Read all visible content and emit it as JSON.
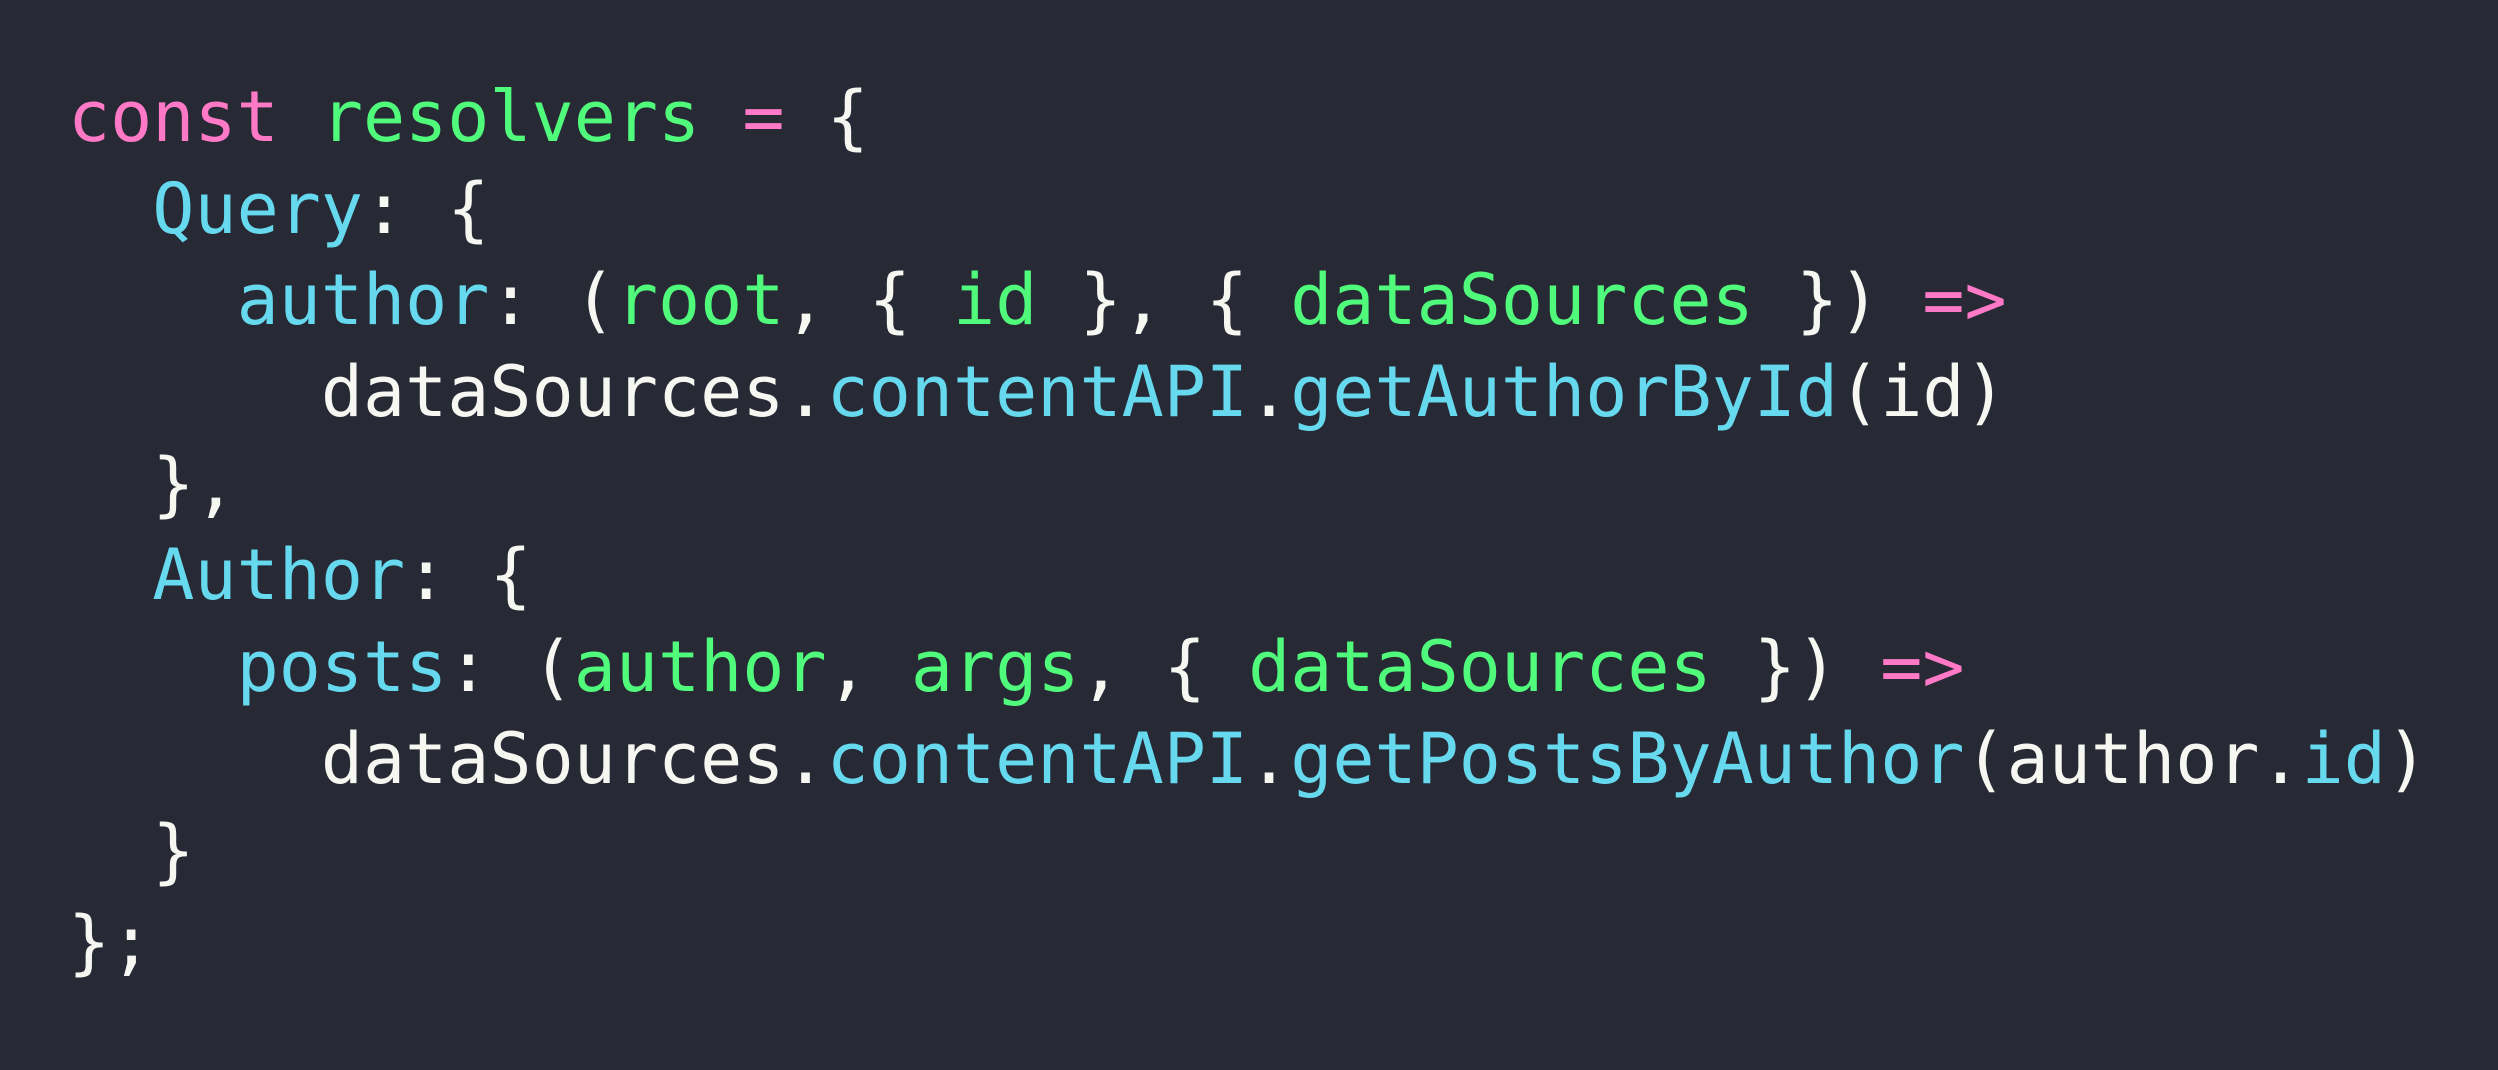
{
  "colors": {
    "background": "#272935",
    "plain": "#f7f7f2",
    "keyword": "#ff79c6",
    "variable": "#50fa7b",
    "property": "#66d9ef"
  },
  "lines": [
    [
      {
        "text": "const",
        "role": "keyword"
      },
      {
        "text": " ",
        "role": "plain"
      },
      {
        "text": "resolvers",
        "role": "variable"
      },
      {
        "text": " ",
        "role": "plain"
      },
      {
        "text": "=",
        "role": "keyword"
      },
      {
        "text": " {",
        "role": "plain"
      }
    ],
    [
      {
        "text": "  ",
        "role": "plain"
      },
      {
        "text": "Query",
        "role": "property"
      },
      {
        "text": ": {",
        "role": "plain"
      }
    ],
    [
      {
        "text": "    ",
        "role": "plain"
      },
      {
        "text": "author",
        "role": "property"
      },
      {
        "text": ": (",
        "role": "plain"
      },
      {
        "text": "root",
        "role": "variable"
      },
      {
        "text": ", { ",
        "role": "plain"
      },
      {
        "text": "id",
        "role": "variable"
      },
      {
        "text": " }, { ",
        "role": "plain"
      },
      {
        "text": "dataSources",
        "role": "variable"
      },
      {
        "text": " }) ",
        "role": "plain"
      },
      {
        "text": "=>",
        "role": "keyword"
      }
    ],
    [
      {
        "text": "      dataSources.",
        "role": "plain"
      },
      {
        "text": "contentAPI",
        "role": "property"
      },
      {
        "text": ".",
        "role": "plain"
      },
      {
        "text": "getAuthorById",
        "role": "property"
      },
      {
        "text": "(id)",
        "role": "plain"
      }
    ],
    [
      {
        "text": "  },",
        "role": "plain"
      }
    ],
    [
      {
        "text": "  ",
        "role": "plain"
      },
      {
        "text": "Author",
        "role": "property"
      },
      {
        "text": ": {",
        "role": "plain"
      }
    ],
    [
      {
        "text": "    ",
        "role": "plain"
      },
      {
        "text": "posts",
        "role": "property"
      },
      {
        "text": ": (",
        "role": "plain"
      },
      {
        "text": "author",
        "role": "variable"
      },
      {
        "text": ", ",
        "role": "plain"
      },
      {
        "text": "args",
        "role": "variable"
      },
      {
        "text": ", { ",
        "role": "plain"
      },
      {
        "text": "dataSources",
        "role": "variable"
      },
      {
        "text": " }) ",
        "role": "plain"
      },
      {
        "text": "=>",
        "role": "keyword"
      }
    ],
    [
      {
        "text": "      dataSources.",
        "role": "plain"
      },
      {
        "text": "contentAPI",
        "role": "property"
      },
      {
        "text": ".",
        "role": "plain"
      },
      {
        "text": "getPostsByAuthor",
        "role": "property"
      },
      {
        "text": "(author.",
        "role": "plain"
      },
      {
        "text": "id",
        "role": "property"
      },
      {
        "text": ")",
        "role": "plain"
      }
    ],
    [
      {
        "text": "  }",
        "role": "plain"
      }
    ],
    [
      {
        "text": "};",
        "role": "plain"
      }
    ]
  ]
}
